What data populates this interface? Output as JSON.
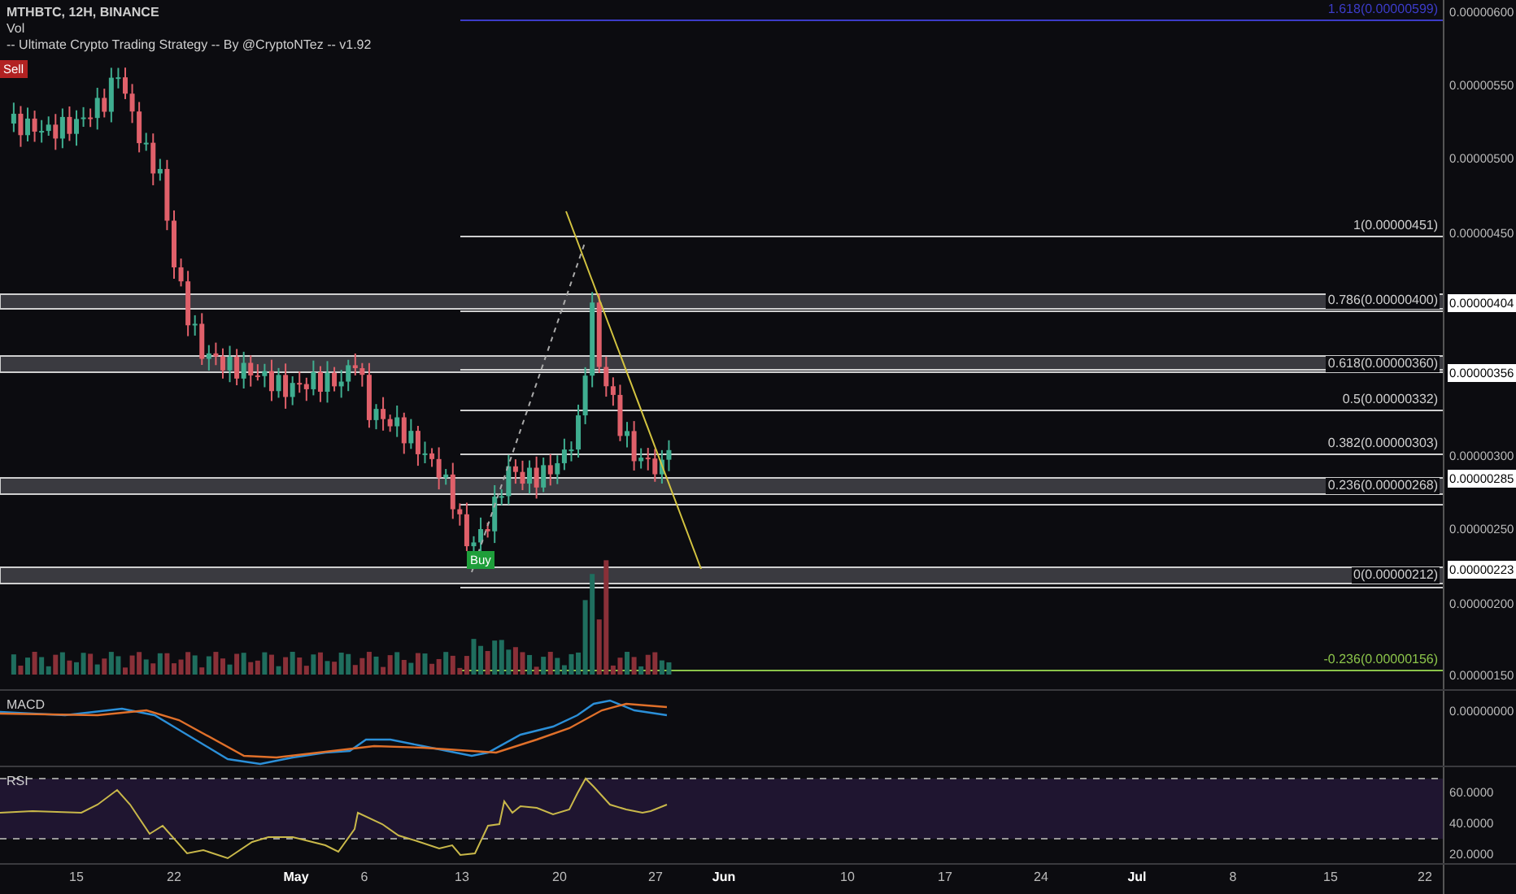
{
  "header": {
    "symbol": "MTHBTC, 12H, BINANCE",
    "indicators": [
      "Vol",
      "-- Ultimate Crypto Trading Strategy -- By @CryptoNTez -- v1.92"
    ]
  },
  "signals": [
    {
      "label": "Sell",
      "kind": "sell"
    },
    {
      "label": "Buy",
      "kind": "buy"
    }
  ],
  "fib_levels": [
    {
      "label": "1.618(0.00000599)",
      "color": "#3c3cc8"
    },
    {
      "label": "1(0.00000451)",
      "color": "#cfcfcf"
    },
    {
      "label": "0.786(0.00000400)",
      "color": "#cfcfcf"
    },
    {
      "label": "0.618(0.00000360)",
      "color": "#cfcfcf"
    },
    {
      "label": "0.5(0.00000332)",
      "color": "#cfcfcf"
    },
    {
      "label": "0.382(0.00000303)",
      "color": "#cfcfcf"
    },
    {
      "label": "0.236(0.00000268)",
      "color": "#cfcfcf"
    },
    {
      "label": "0(0.00000212)",
      "color": "#cfcfcf"
    },
    {
      "label": "-0.236(0.00000156)",
      "color": "#8bc34a"
    }
  ],
  "price_axis": [
    {
      "label": "0.00000600",
      "highlighted": false
    },
    {
      "label": "0.00000550",
      "highlighted": false
    },
    {
      "label": "0.00000500",
      "highlighted": false
    },
    {
      "label": "0.00000450",
      "highlighted": false
    },
    {
      "label": "0.00000404",
      "highlighted": true
    },
    {
      "label": "0.00000356",
      "highlighted": true
    },
    {
      "label": "0.00000300",
      "highlighted": false
    },
    {
      "label": "0.00000285",
      "highlighted": true
    },
    {
      "label": "0.00000250",
      "highlighted": false
    },
    {
      "label": "0.00000223",
      "highlighted": true
    },
    {
      "label": "0.00000200",
      "highlighted": false
    },
    {
      "label": "0.00000150",
      "highlighted": false
    }
  ],
  "macd": {
    "title": "MACD",
    "axis": [
      "0.00000000"
    ]
  },
  "rsi": {
    "title": "RSI",
    "axis": [
      "60.0000",
      "40.0000",
      "20.0000"
    ]
  },
  "time_axis": [
    {
      "label": "15",
      "kind": "day"
    },
    {
      "label": "22",
      "kind": "day"
    },
    {
      "label": "May",
      "kind": "month"
    },
    {
      "label": "6",
      "kind": "day"
    },
    {
      "label": "13",
      "kind": "day"
    },
    {
      "label": "20",
      "kind": "day"
    },
    {
      "label": "27",
      "kind": "day"
    },
    {
      "label": "Jun",
      "kind": "month"
    },
    {
      "label": "10",
      "kind": "day"
    },
    {
      "label": "17",
      "kind": "day"
    },
    {
      "label": "24",
      "kind": "day"
    },
    {
      "label": "Jul",
      "kind": "month"
    },
    {
      "label": "8",
      "kind": "day"
    },
    {
      "label": "15",
      "kind": "day"
    },
    {
      "label": "22",
      "kind": "day"
    }
  ]
}
